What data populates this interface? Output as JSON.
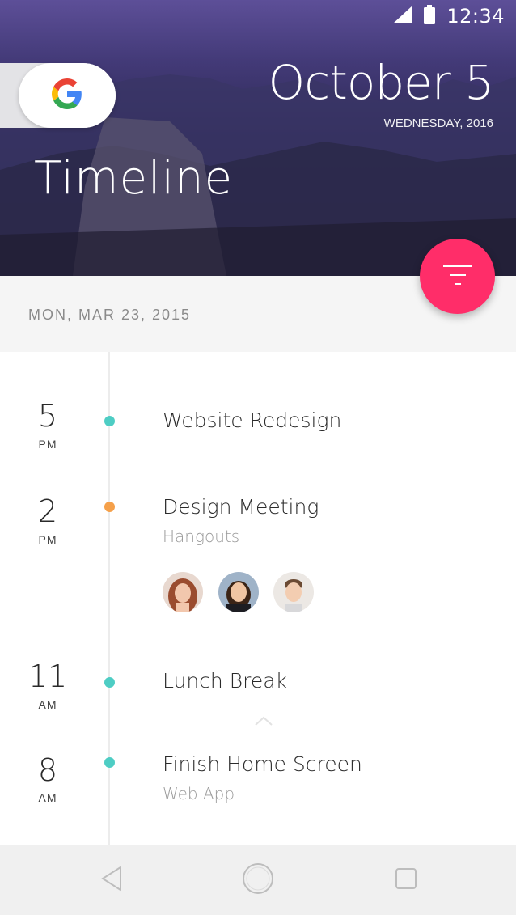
{
  "status_bar": {
    "time": "12:34",
    "signal_icon": "signal-icon",
    "battery_icon": "battery-icon"
  },
  "header": {
    "date_big": "October 5",
    "date_sub": "WEDNESDAY, 2016",
    "title": "Timeline",
    "google_button_icon": "google-logo-icon"
  },
  "fab": {
    "icon": "filter-icon",
    "color": "#ff2d69"
  },
  "day_label": "MON, MAR 23, 2015",
  "events": [
    {
      "hour": "5",
      "ampm": "PM",
      "title": "Website Redesign",
      "subtitle": "",
      "dot_color": "#4ecdc4"
    },
    {
      "hour": "2",
      "ampm": "PM",
      "title": "Design Meeting",
      "subtitle": "Hangouts",
      "dot_color": "#f5a04a",
      "attendees": [
        "attendee-1",
        "attendee-2",
        "attendee-3"
      ]
    },
    {
      "hour": "11",
      "ampm": "AM",
      "title": "Lunch Break",
      "subtitle": "",
      "dot_color": "#4ecdc4"
    },
    {
      "hour": "8",
      "ampm": "AM",
      "title": "Finish Home Screen",
      "subtitle": "Web App",
      "dot_color": "#4ecdc4"
    }
  ],
  "nav": {
    "back_icon": "back-icon",
    "home_icon": "home-icon",
    "recents_icon": "recents-icon"
  }
}
